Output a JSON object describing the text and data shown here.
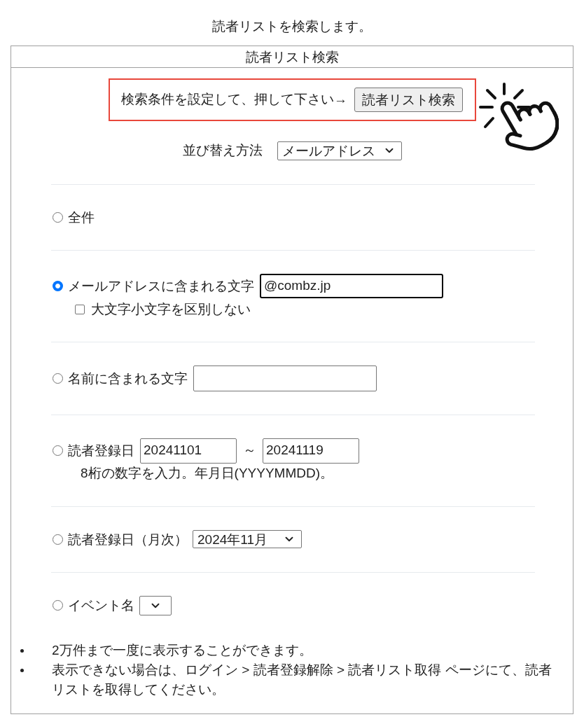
{
  "page_heading": "読者リストを検索します。",
  "panel": {
    "title": "読者リスト検索"
  },
  "search_prompt": {
    "text": "検索条件を設定して、押して下さい→",
    "button": "読者リスト検索",
    "highlighted": true
  },
  "sort": {
    "label": "並び替え方法",
    "value": "メールアドレス"
  },
  "conditions": [
    {
      "kind": "plain",
      "label": "全件",
      "selected": false
    },
    {
      "kind": "text",
      "label": "メールアドレスに含まれる文字",
      "selected": true,
      "value": "@combz.jp",
      "focused": true,
      "option": {
        "label": "大文字小文字を区別しない",
        "checked": false
      }
    },
    {
      "kind": "text",
      "label": "名前に含まれる文字",
      "selected": false,
      "focused": false
    },
    {
      "kind": "range",
      "label": "読者登録日",
      "selected": false,
      "from": "20241101",
      "separator": "～",
      "to": "20241119",
      "hint": "8桁の数字を入力。年月日(YYYYMMDD)。"
    },
    {
      "kind": "select",
      "label": "読者登録日（月次）",
      "selected": false,
      "value": "2024年11月"
    },
    {
      "kind": "select",
      "label": "イベント名",
      "selected": false
    }
  ],
  "notes": [
    "2万件まで一度に表示することができます。",
    "表示できない場合は、ログイン > 読者登録解除 > 読者リスト取得 ページにて、読者リストを取得してください。"
  ]
}
